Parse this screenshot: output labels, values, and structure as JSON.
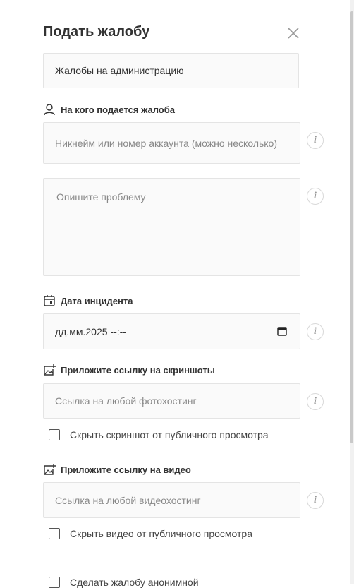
{
  "dialog": {
    "title": "Подать жалобу"
  },
  "category": {
    "value": "Жалобы на администрацию"
  },
  "target": {
    "label": "На кого подается жалоба",
    "placeholder": "Никнейм или номер аккаунта (можно несколько)"
  },
  "description": {
    "placeholder": "Опишите проблему"
  },
  "incident_date": {
    "label": "Дата инцидента",
    "value": "дд.мм.2025 --:--"
  },
  "screenshots": {
    "label": "Приложите ссылку на скриншоты",
    "placeholder": "Ссылка на любой фотохостинг",
    "hide_label": "Скрыть скриншот от публичного просмотра"
  },
  "video": {
    "label": "Приложите ссылку на видео",
    "placeholder": "Ссылка на любой видеохостинг",
    "hide_label": "Скрыть видео от публичного просмотра"
  },
  "anonymous": {
    "label": "Сделать жалобу анонимной"
  },
  "info_glyph": "i"
}
